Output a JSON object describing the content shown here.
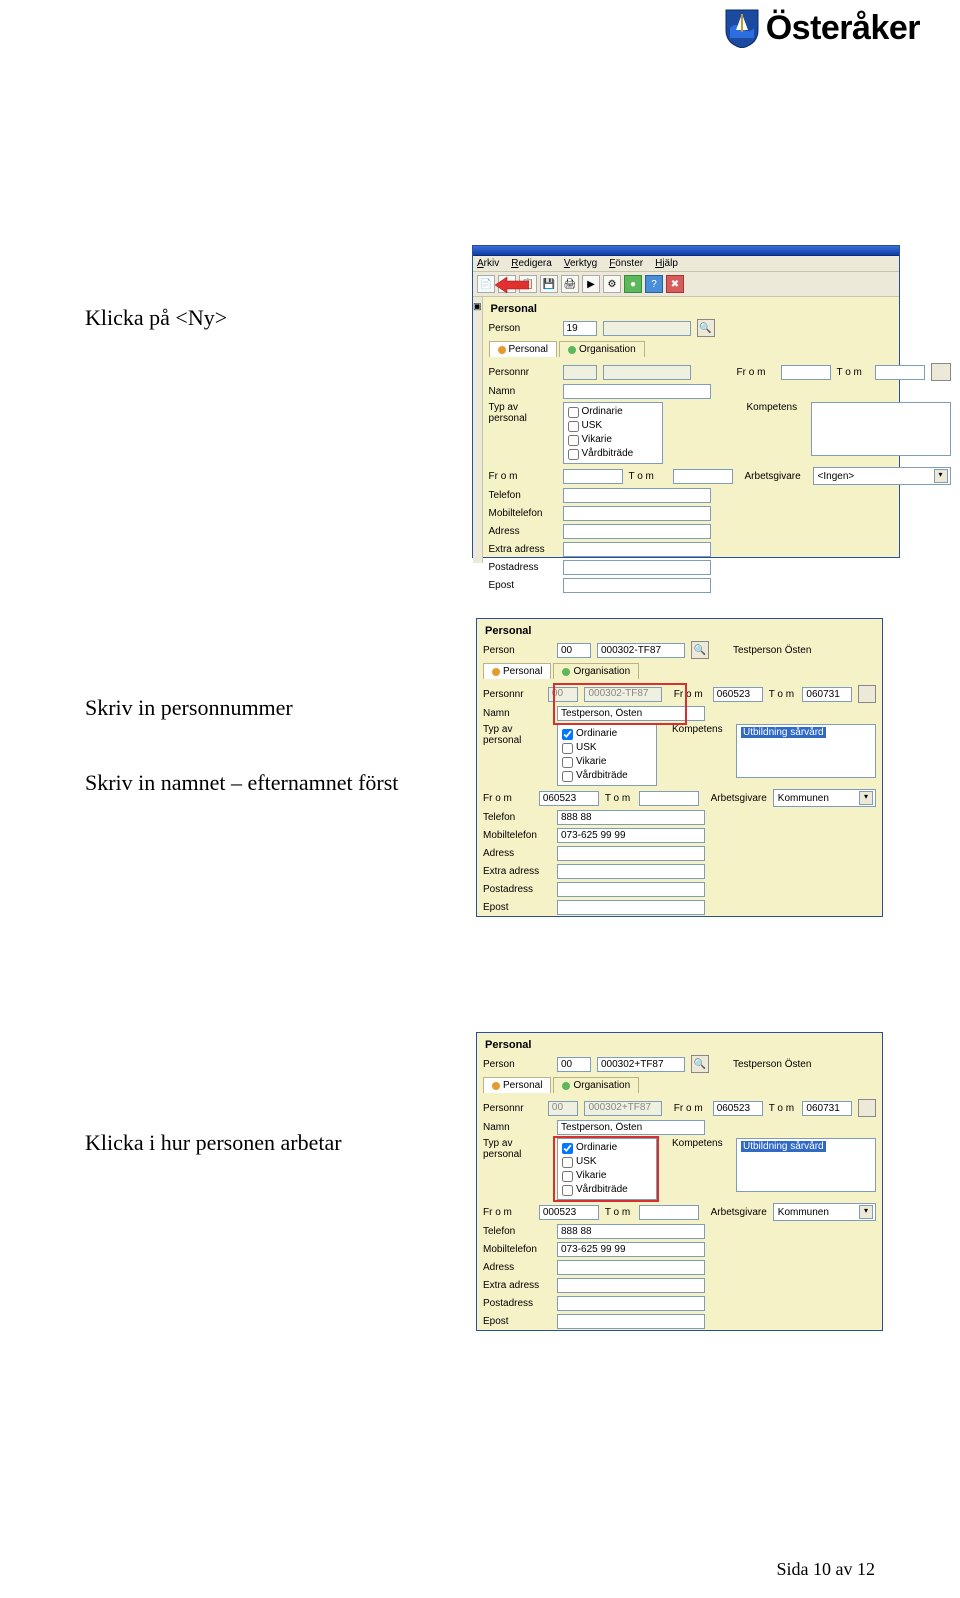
{
  "logo": {
    "text": "Österåker"
  },
  "instructions": {
    "i1": "Klicka på <Ny>",
    "i2": "Skriv in personnummer",
    "i3": "Skriv in namnet – efternamnet först",
    "i4": "Klicka i hur personen arbetar"
  },
  "footer": "Sida 10 av 12",
  "menubar": {
    "arkiv": "Arkiv",
    "redigera": "Redigera",
    "verktyg": "Verktyg",
    "fonster": "Fönster",
    "hjalp": "Hjälp"
  },
  "panel": {
    "title": "Personal",
    "tab_personal": "Personal",
    "tab_organisation": "Organisation",
    "labels": {
      "person": "Person",
      "personnr": "Personnr",
      "from": "Fr o m",
      "tom": "T o m",
      "namn": "Namn",
      "typ": "Typ av personal",
      "kompetens": "Kompetens",
      "arbetsgivare": "Arbetsgivare",
      "telefon": "Telefon",
      "mobil": "Mobiltelefon",
      "adress": "Adress",
      "extra": "Extra adress",
      "postadress": "Postadress",
      "epost": "Epost"
    },
    "checkboxes": {
      "ordinarie": "Ordinarie",
      "usk": "USK",
      "vikarie": "Vikarie",
      "vardbitrade": "Vårdbiträde"
    }
  },
  "shot1": {
    "person_id": "19",
    "arbetsgivare": "<Ingen>"
  },
  "shot2": {
    "person_prefix": "00",
    "personnr": "000302-TF87",
    "person_name": "Testperson Östen",
    "namn": "Testperson, Östen",
    "from": "060523",
    "tom": "060731",
    "from2": "060523",
    "telefon": "888 88",
    "mobil": "073-625 99 99",
    "arbetsgivare": "Kommunen",
    "kompetens": "Utbildning sårvård"
  },
  "shot3": {
    "person_prefix": "00",
    "personnr": "000302+TF87",
    "person_name": "Testperson Östen",
    "namn": "Testperson, Östen",
    "from": "060523",
    "tom": "060731",
    "from2": "000523",
    "telefon": "888 88",
    "mobil": "073-625 99 99",
    "arbetsgivare": "Kommunen",
    "kompetens": "Utbildning sårvård"
  }
}
